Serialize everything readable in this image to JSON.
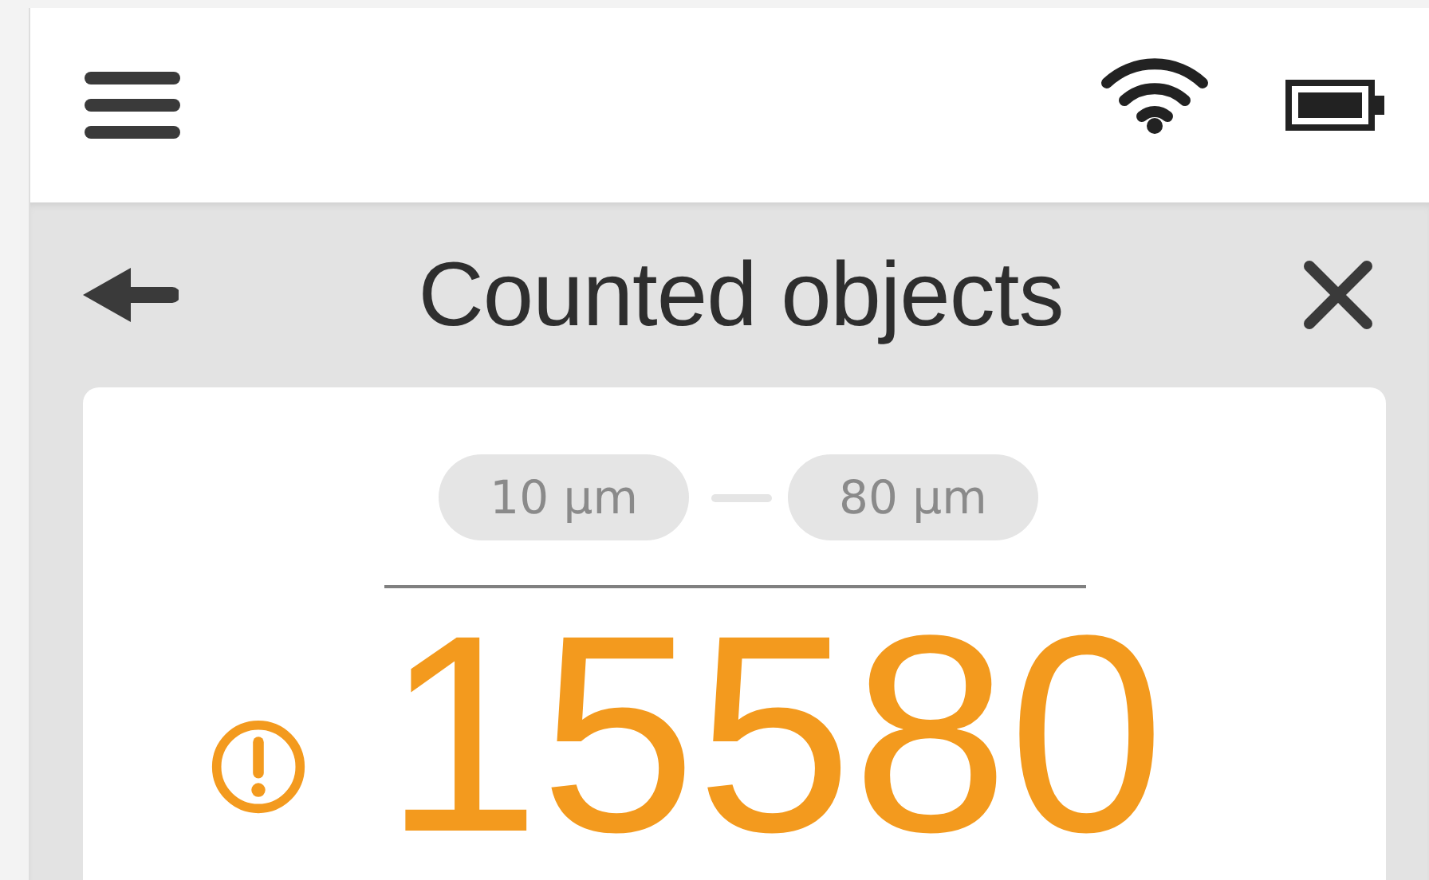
{
  "header": {
    "title": "Counted objects"
  },
  "range": {
    "min": "10 µm",
    "max": "80 µm"
  },
  "result": {
    "count": "15580",
    "warning": true
  }
}
